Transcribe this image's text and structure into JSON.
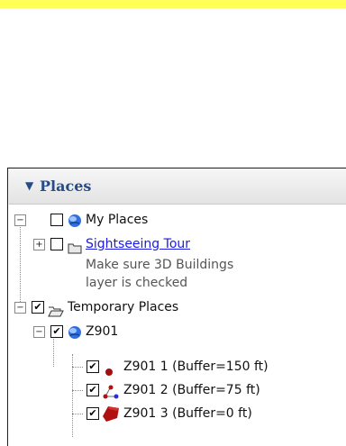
{
  "panel": {
    "title": "Places",
    "collapse_glyph": "▼",
    "tree": {
      "my_places": {
        "label": "My Places",
        "checked": false,
        "expander": "−",
        "icon": "globe-icon",
        "children": {
          "sightseeing": {
            "label": "Sightseeing Tour",
            "checked": false,
            "expander": "+",
            "icon": "folder-icon",
            "description_line1": "Make sure 3D Buildings",
            "description_line2": "layer is checked"
          }
        }
      },
      "temporary_places": {
        "label": "Temporary Places",
        "checked": true,
        "expander": "−",
        "icon": "open-folder-icon",
        "z901": {
          "label": "Z901",
          "checked": true,
          "expander": "−",
          "icon": "globe-icon",
          "items": [
            {
              "label": "Z901 1 (Buffer=150 ft)",
              "checked": true,
              "icon": "dot-icon"
            },
            {
              "label": "Z901 2 (Buffer=75 ft)",
              "checked": true,
              "icon": "points-icon"
            },
            {
              "label": "Z901 3 (Buffer=0 ft)",
              "checked": true,
              "icon": "polygon-icon"
            }
          ]
        }
      }
    },
    "check_glyph": "✔"
  },
  "colors": {
    "header_text": "#274c84",
    "link": "#1a1ae6",
    "top_strip": "#ffff55",
    "polygon": "#b01010",
    "dot": "#a01010"
  }
}
